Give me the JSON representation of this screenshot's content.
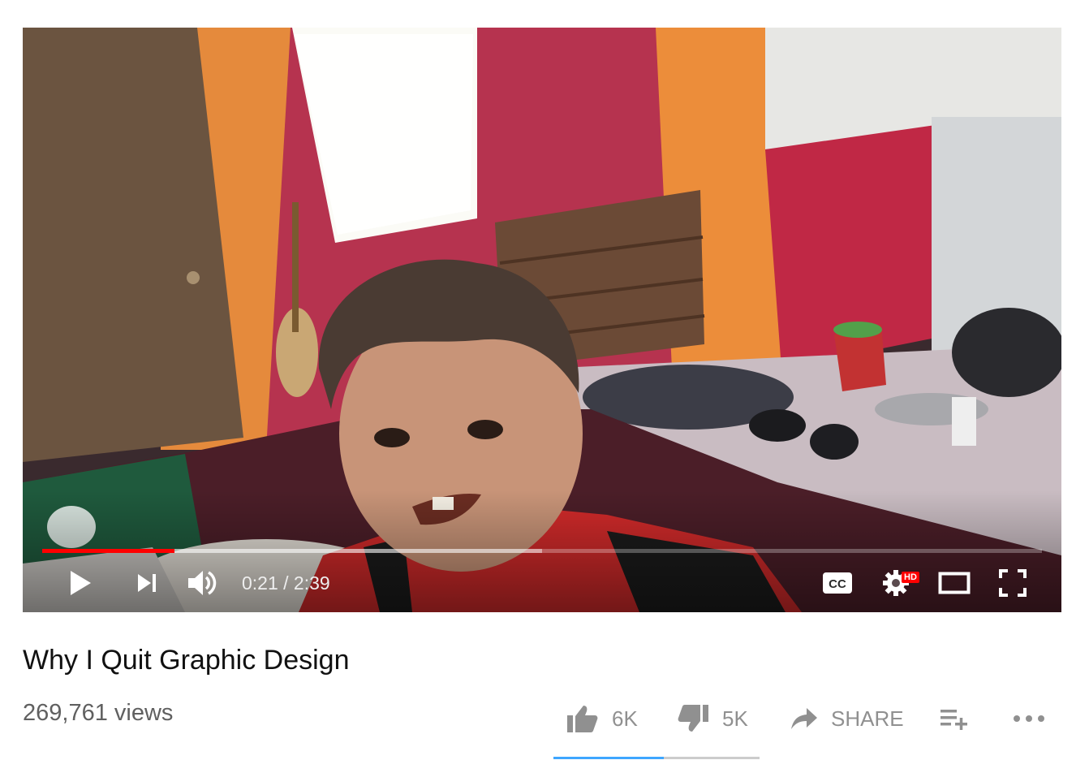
{
  "player": {
    "current_time": "0:21",
    "duration": "2:39",
    "time_display": "0:21 / 2:39",
    "progress_fraction": 0.132,
    "buffered_fraction": 0.5,
    "hd_badge": "HD",
    "icons": {
      "play": "play-icon",
      "next": "next-icon",
      "volume": "volume-icon",
      "captions": "cc-icon",
      "settings": "gear-icon",
      "theater": "theater-icon",
      "fullscreen": "fullscreen-icon"
    }
  },
  "video": {
    "title": "Why I Quit Graphic Design",
    "views": "269,761 views"
  },
  "actions": {
    "like_count": "6K",
    "dislike_count": "5K",
    "share_label": "SHARE",
    "like_fraction": 0.537,
    "icons": {
      "like": "thumbs-up-icon",
      "dislike": "thumbs-down-icon",
      "share": "share-arrow-icon",
      "add_to_playlist": "playlist-add-icon",
      "more": "more-icon"
    }
  },
  "colors": {
    "accent_red": "#ff0000",
    "like_bar": "#3ea6ff"
  }
}
